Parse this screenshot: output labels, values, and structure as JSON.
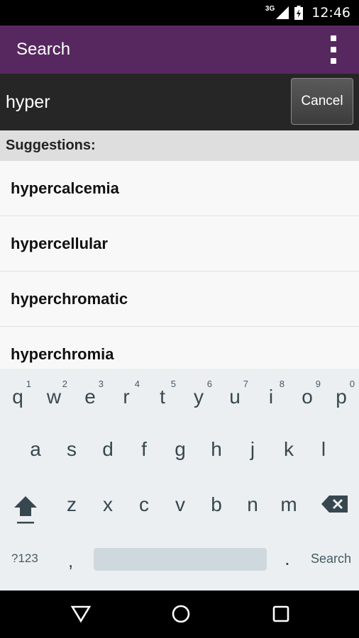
{
  "status": {
    "network": "3G",
    "time": "12:46"
  },
  "appbar": {
    "title": "Search"
  },
  "search": {
    "query": "hyper",
    "cancel_label": "Cancel"
  },
  "suggestions": {
    "header": "Suggestions:",
    "items": [
      "hypercalcemia",
      "hypercellular",
      "hyperchromatic",
      "hyperchromia"
    ]
  },
  "keyboard": {
    "row1": [
      {
        "key": "q",
        "hint": "1"
      },
      {
        "key": "w",
        "hint": "2"
      },
      {
        "key": "e",
        "hint": "3"
      },
      {
        "key": "r",
        "hint": "4"
      },
      {
        "key": "t",
        "hint": "5"
      },
      {
        "key": "y",
        "hint": "6"
      },
      {
        "key": "u",
        "hint": "7"
      },
      {
        "key": "i",
        "hint": "8"
      },
      {
        "key": "o",
        "hint": "9"
      },
      {
        "key": "p",
        "hint": "0"
      }
    ],
    "row2": [
      "a",
      "s",
      "d",
      "f",
      "g",
      "h",
      "j",
      "k",
      "l"
    ],
    "row3": [
      "z",
      "x",
      "c",
      "v",
      "b",
      "n",
      "m"
    ],
    "symbols_label": "?123",
    "comma": ",",
    "period": ".",
    "action_label": "Search"
  }
}
